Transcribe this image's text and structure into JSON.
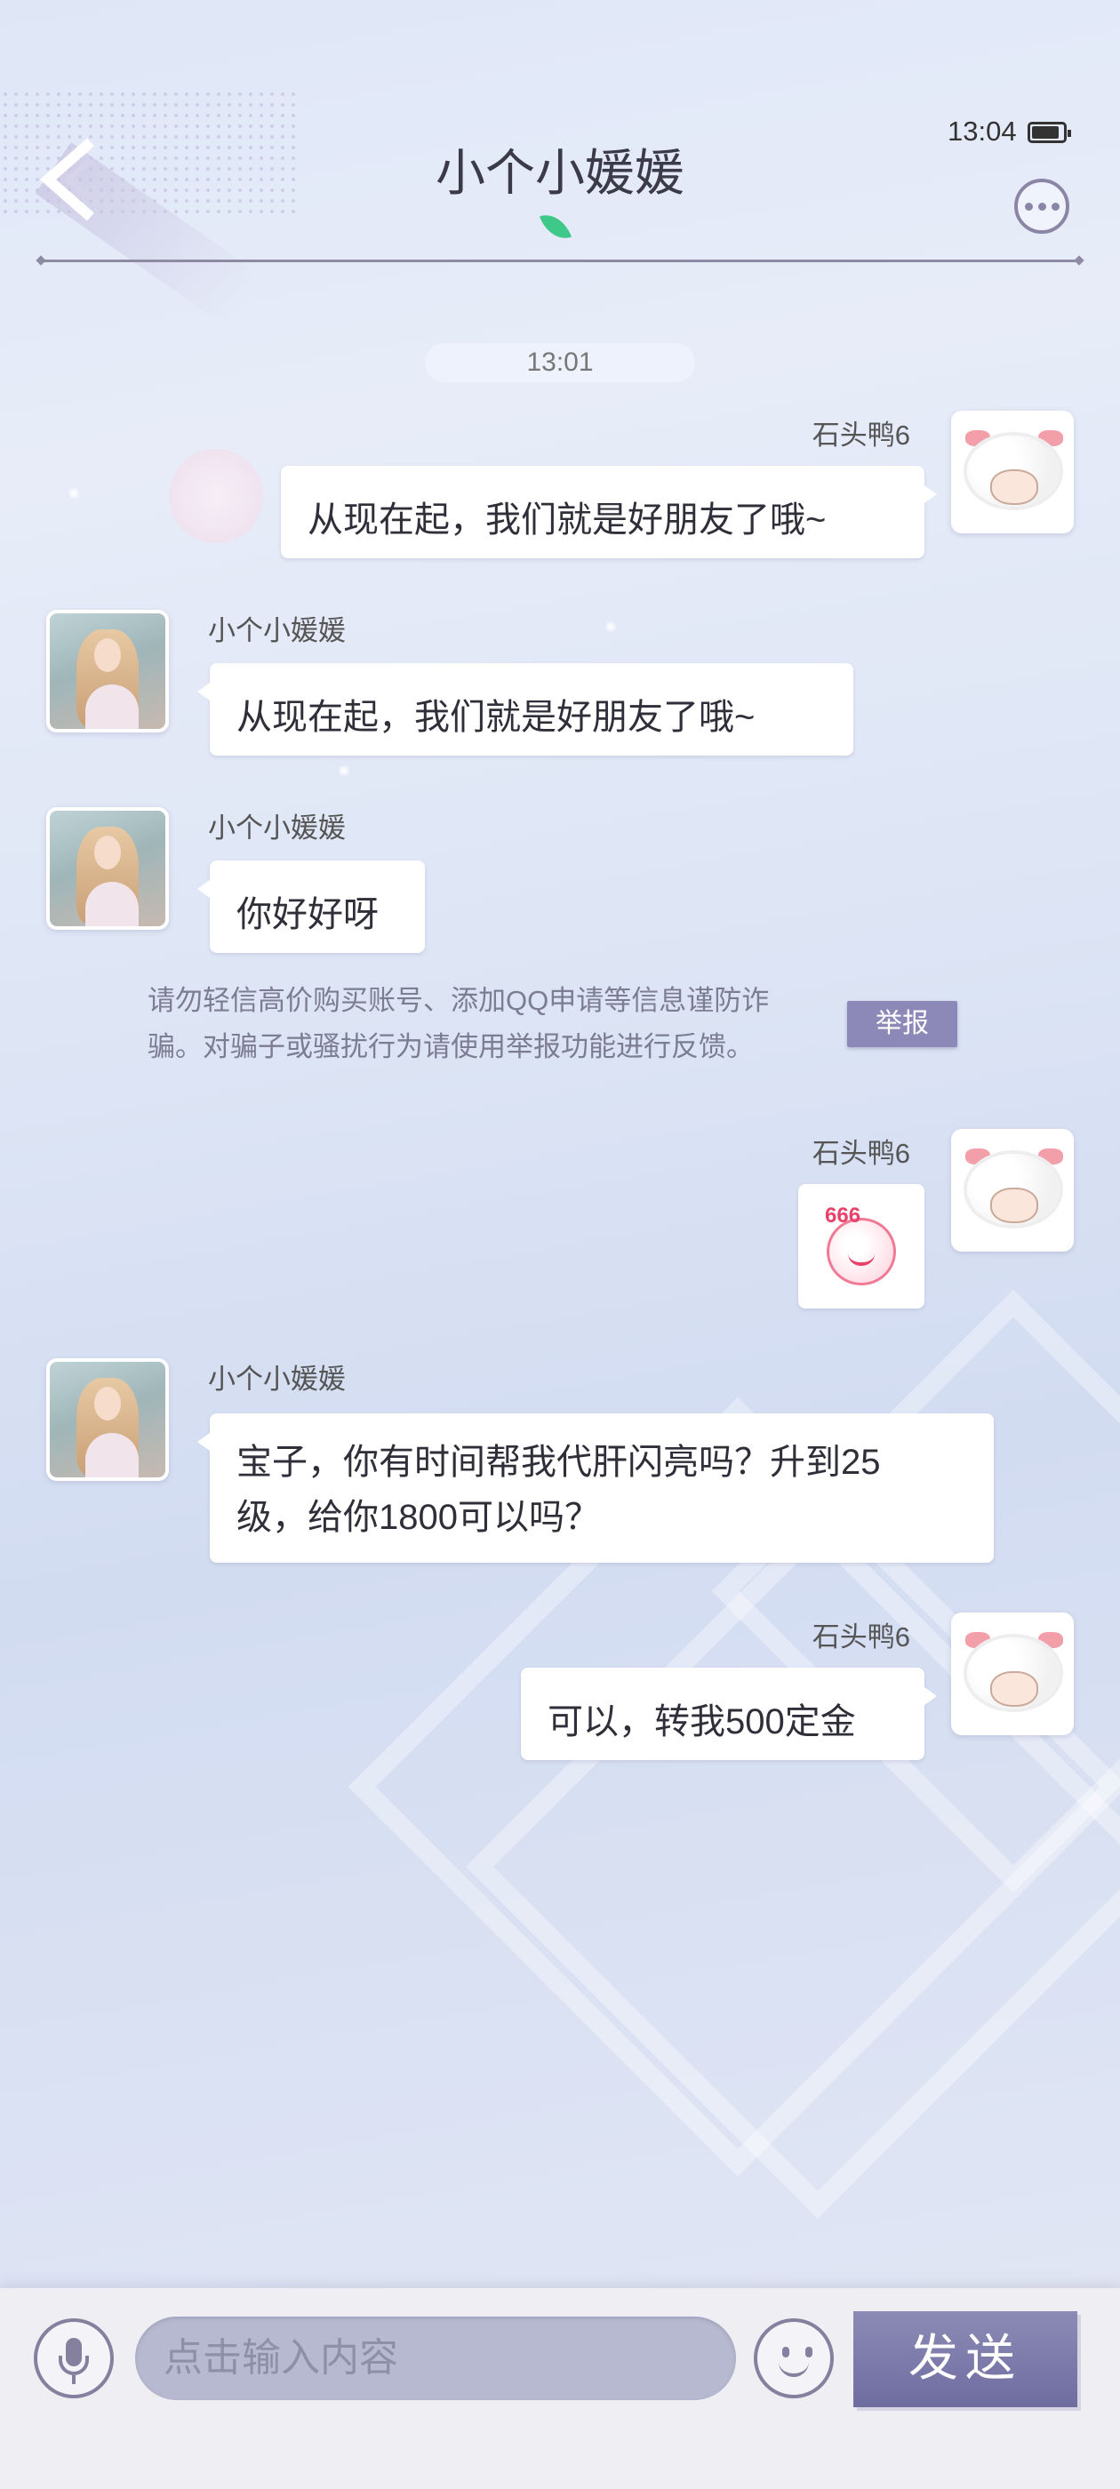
{
  "status": {
    "time": "13:04"
  },
  "header": {
    "title": "小个小媛媛"
  },
  "chat": {
    "timestamp": "13:01",
    "messages": [
      {
        "sender": "石头鸭6",
        "text": "从现在起，我们就是好朋友了哦~"
      },
      {
        "sender": "小个小媛媛",
        "text": "从现在起，我们就是好朋友了哦~"
      },
      {
        "sender": "小个小媛媛",
        "text": "你好好呀"
      },
      {
        "sender": "石头鸭6",
        "sticker_label": "666"
      },
      {
        "sender": "小个小媛媛",
        "text_line1": "宝子，你有时间帮我代肝闪亮吗？升到25",
        "text_line2": "级，给你1800可以吗？"
      },
      {
        "sender": "石头鸭6",
        "text": "可以，转我500定金"
      }
    ],
    "notice": {
      "line1": "请勿轻信高价购买账号、添加QQ申请等信息谨防诈",
      "line2": "骗。对骗子或骚扰行为请使用举报功能进行反馈。",
      "report_label": "举报"
    }
  },
  "input": {
    "placeholder": "点击输入内容",
    "send_label": "发送"
  },
  "icons": {
    "back": "back-arrow-icon",
    "more": "more-dots-icon",
    "mic": "microphone-icon",
    "emoji": "emoji-face-icon",
    "leaf": "leaf-icon",
    "battery": "battery-icon"
  },
  "colors": {
    "accent": "#8c89b9",
    "send_button": "#6f6da0",
    "input_background": "#b7b9d0",
    "leaf": "#3ec98a"
  }
}
